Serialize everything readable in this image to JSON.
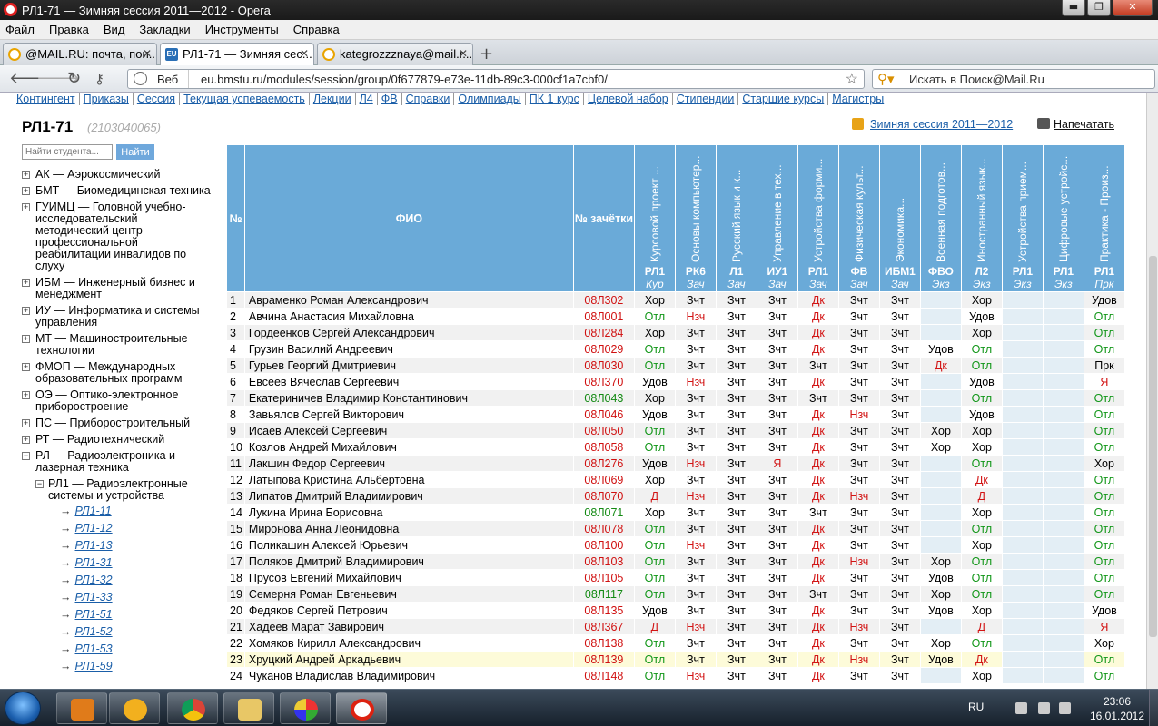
{
  "window": {
    "title": "РЛ1-71 — Зимняя сессия 2011—2012 - Opera",
    "min": "▬",
    "max": "❐",
    "close": "✕"
  },
  "menu": [
    "Файл",
    "Правка",
    "Вид",
    "Закладки",
    "Инструменты",
    "Справка"
  ],
  "tabs": [
    {
      "label": "@MAIL.RU: почта, пои...",
      "active": false
    },
    {
      "label": "РЛ1-71 — Зимняя сес...",
      "active": true
    },
    {
      "label": "kategrozzznaya@mail.r...",
      "active": false
    }
  ],
  "address": {
    "web_label": "Веб",
    "url": "eu.bmstu.ru/modules/session/group/0f677879-e73e-11db-89c3-000cf1a7cbf0/",
    "search_placeholder": "Искать в Поиск@Mail.Ru"
  },
  "topnav": [
    "Контингент",
    "Приказы",
    "Сессия",
    "Текущая успеваемость",
    "Лекции",
    "Л4",
    "ФВ",
    "Справки",
    "Олимпиады",
    "ПК 1 курс",
    "Целевой набор",
    "Стипендии",
    "Старшие курсы",
    "Магистры"
  ],
  "group": {
    "title": "РЛ1-71",
    "code": "(2103040065)"
  },
  "session_link": "Зимняя сессия 2011—2012",
  "print_link": "Напечатать",
  "search": {
    "placeholder": "Найти студента...",
    "button": "Найти"
  },
  "tree": [
    {
      "abbr": "АК",
      "name": "Аэрокосмический"
    },
    {
      "abbr": "БМТ",
      "name": "Биомедицинская техника"
    },
    {
      "abbr": "ГУИМЦ",
      "name": "Головной учебно-исследовательский методический центр профессиональной реабилитации инвалидов по слуху"
    },
    {
      "abbr": "ИБМ",
      "name": "Инженерный бизнес и менеджмент"
    },
    {
      "abbr": "ИУ",
      "name": "Информатика и системы управления"
    },
    {
      "abbr": "МТ",
      "name": "Машиностроительные технологии"
    },
    {
      "abbr": "ФМОП",
      "name": "Международных образовательных программ"
    },
    {
      "abbr": "ОЭ",
      "name": "Оптико-электронное приборостроение"
    },
    {
      "abbr": "ПС",
      "name": "Приборостроительный"
    },
    {
      "abbr": "РТ",
      "name": "Радиотехнический"
    },
    {
      "abbr": "РЛ",
      "name": "Радиоэлектроника и лазерная техника",
      "expanded": true
    }
  ],
  "tree_sub": {
    "abbr": "РЛ1",
    "name": "Радиоэлектронные системы и устройства"
  },
  "tree_groups": [
    "РЛ1-11",
    "РЛ1-12",
    "РЛ1-13",
    "РЛ1-31",
    "РЛ1-32",
    "РЛ1-33",
    "РЛ1-51",
    "РЛ1-52",
    "РЛ1-53",
    "РЛ1-59"
  ],
  "table": {
    "h_num": "№",
    "h_fio": "ФИО",
    "h_rec": "№ зачётки",
    "subjects": [
      {
        "name": "Курсовой проект ...",
        "code": "РЛ1",
        "kind": "Кур"
      },
      {
        "name": "Основы компьютер...",
        "code": "РК6",
        "kind": "Зач"
      },
      {
        "name": "Русский язык и к...",
        "code": "Л1",
        "kind": "Зач"
      },
      {
        "name": "Управление в тех...",
        "code": "ИУ1",
        "kind": "Зач"
      },
      {
        "name": "Устройства форми...",
        "code": "РЛ1",
        "kind": "Зач"
      },
      {
        "name": "Физическая культ...",
        "code": "ФВ",
        "kind": "Зач"
      },
      {
        "name": "Экономика...",
        "code": "ИБМ1",
        "kind": "Зач"
      },
      {
        "name": "Военная подготов...",
        "code": "ФВО",
        "kind": "Экз"
      },
      {
        "name": "Иностранный язык...",
        "code": "Л2",
        "kind": "Экз"
      },
      {
        "name": "Устройства прием...",
        "code": "РЛ1",
        "kind": "Экз"
      },
      {
        "name": "Цифровые устройс...",
        "code": "РЛ1",
        "kind": "Экз"
      },
      {
        "name": "Практика - Произ...",
        "code": "РЛ1",
        "kind": "Прк"
      }
    ],
    "rows": [
      {
        "n": "1",
        "fio": "Авраменко Роман Александрович",
        "rec": "08Л302",
        "rc": "red",
        "g": [
          "Хор",
          "Зчт",
          "Зчт",
          "Зчт",
          "Дк",
          "Зчт",
          "Зчт",
          "",
          "Хор",
          "",
          "",
          "Удов"
        ]
      },
      {
        "n": "2",
        "fio": "Авчина Анастасия Михайловна",
        "rec": "08Л001",
        "rc": "red",
        "g": [
          "Отл",
          "Нзч",
          "Зчт",
          "Зчт",
          "Дк",
          "Зчт",
          "Зчт",
          "",
          "Удов",
          "",
          "",
          "Отл"
        ]
      },
      {
        "n": "3",
        "fio": "Гордеенков Сергей Александрович",
        "rec": "08Л284",
        "rc": "red",
        "g": [
          "Хор",
          "Зчт",
          "Зчт",
          "Зчт",
          "Дк",
          "Зчт",
          "Зчт",
          "",
          "Хор",
          "",
          "",
          "Отл"
        ]
      },
      {
        "n": "4",
        "fio": "Грузин Василий Андреевич",
        "rec": "08Л029",
        "rc": "red",
        "g": [
          "Отл",
          "Зчт",
          "Зчт",
          "Зчт",
          "Дк",
          "Зчт",
          "Зчт",
          "Удов",
          "Отл",
          "",
          "",
          "Отл"
        ]
      },
      {
        "n": "5",
        "fio": "Гурьев Георгий Дмитриевич",
        "rec": "08Л030",
        "rc": "red",
        "g": [
          "Отл",
          "Зчт",
          "Зчт",
          "Зчт",
          "Зчт",
          "Зчт",
          "Зчт",
          "Дк",
          "Отл",
          "",
          "",
          "Прк"
        ]
      },
      {
        "n": "6",
        "fio": "Евсеев Вячеслав Сергеевич",
        "rec": "08Л370",
        "rc": "red",
        "g": [
          "Удов",
          "Нзч",
          "Зчт",
          "Зчт",
          "Дк",
          "Зчт",
          "Зчт",
          "",
          "Удов",
          "",
          "",
          "Я"
        ]
      },
      {
        "n": "7",
        "fio": "Екатериничев Владимир Константинович",
        "rec": "08Л043",
        "rc": "green",
        "g": [
          "Хор",
          "Зчт",
          "Зчт",
          "Зчт",
          "Зчт",
          "Зчт",
          "Зчт",
          "",
          "Отл",
          "",
          "",
          "Отл"
        ]
      },
      {
        "n": "8",
        "fio": "Завьялов Сергей Викторович",
        "rec": "08Л046",
        "rc": "red",
        "g": [
          "Удов",
          "Зчт",
          "Зчт",
          "Зчт",
          "Дк",
          "Нзч",
          "Зчт",
          "",
          "Удов",
          "",
          "",
          "Отл"
        ]
      },
      {
        "n": "9",
        "fio": "Исаев Алексей Сергеевич",
        "rec": "08Л050",
        "rc": "red",
        "g": [
          "Отл",
          "Зчт",
          "Зчт",
          "Зчт",
          "Дк",
          "Зчт",
          "Зчт",
          "Хор",
          "Хор",
          "",
          "",
          "Отл"
        ]
      },
      {
        "n": "10",
        "fio": "Козлов Андрей Михайлович",
        "rec": "08Л058",
        "rc": "red",
        "g": [
          "Отл",
          "Зчт",
          "Зчт",
          "Зчт",
          "Дк",
          "Зчт",
          "Зчт",
          "Хор",
          "Хор",
          "",
          "",
          "Отл"
        ]
      },
      {
        "n": "11",
        "fio": "Лакшин Федор Сергеевич",
        "rec": "08Л276",
        "rc": "red",
        "g": [
          "Удов",
          "Нзч",
          "Зчт",
          "Я",
          "Дк",
          "Зчт",
          "Зчт",
          "",
          "Отл",
          "",
          "",
          "Хор"
        ]
      },
      {
        "n": "12",
        "fio": "Латыпова Кристина Альбертовна",
        "rec": "08Л069",
        "rc": "red",
        "g": [
          "Хор",
          "Зчт",
          "Зчт",
          "Зчт",
          "Дк",
          "Зчт",
          "Зчт",
          "",
          "Дк",
          "",
          "",
          "Отл"
        ]
      },
      {
        "n": "13",
        "fio": "Липатов Дмитрий Владимирович",
        "rec": "08Л070",
        "rc": "red",
        "g": [
          "Д",
          "Нзч",
          "Зчт",
          "Зчт",
          "Дк",
          "Нзч",
          "Зчт",
          "",
          "Д",
          "",
          "",
          "Отл"
        ]
      },
      {
        "n": "14",
        "fio": "Лукина Ирина Борисовна",
        "rec": "08Л071",
        "rc": "green",
        "g": [
          "Хор",
          "Зчт",
          "Зчт",
          "Зчт",
          "Зчт",
          "Зчт",
          "Зчт",
          "",
          "Хор",
          "",
          "",
          "Отл"
        ]
      },
      {
        "n": "15",
        "fio": "Миронова Анна Леонидовна",
        "rec": "08Л078",
        "rc": "red",
        "g": [
          "Отл",
          "Зчт",
          "Зчт",
          "Зчт",
          "Дк",
          "Зчт",
          "Зчт",
          "",
          "Отл",
          "",
          "",
          "Отл"
        ]
      },
      {
        "n": "16",
        "fio": "Поликашин Алексей Юрьевич",
        "rec": "08Л100",
        "rc": "red",
        "g": [
          "Отл",
          "Нзч",
          "Зчт",
          "Зчт",
          "Дк",
          "Зчт",
          "Зчт",
          "",
          "Хор",
          "",
          "",
          "Отл"
        ]
      },
      {
        "n": "17",
        "fio": "Поляков Дмитрий Владимирович",
        "rec": "08Л103",
        "rc": "red",
        "g": [
          "Отл",
          "Зчт",
          "Зчт",
          "Зчт",
          "Дк",
          "Нзч",
          "Зчт",
          "Хор",
          "Отл",
          "",
          "",
          "Отл"
        ]
      },
      {
        "n": "18",
        "fio": "Прусов Евгений Михайлович",
        "rec": "08Л105",
        "rc": "red",
        "g": [
          "Отл",
          "Зчт",
          "Зчт",
          "Зчт",
          "Дк",
          "Зчт",
          "Зчт",
          "Удов",
          "Отл",
          "",
          "",
          "Отл"
        ]
      },
      {
        "n": "19",
        "fio": "Семерня Роман Евгеньевич",
        "rec": "08Л117",
        "rc": "green",
        "g": [
          "Отл",
          "Зчт",
          "Зчт",
          "Зчт",
          "Зчт",
          "Зчт",
          "Зчт",
          "Хор",
          "Отл",
          "",
          "",
          "Отл"
        ]
      },
      {
        "n": "20",
        "fio": "Федяков Сергей Петрович",
        "rec": "08Л135",
        "rc": "red",
        "g": [
          "Удов",
          "Зчт",
          "Зчт",
          "Зчт",
          "Дк",
          "Зчт",
          "Зчт",
          "Удов",
          "Хор",
          "",
          "",
          "Удов"
        ]
      },
      {
        "n": "21",
        "fio": "Хадеев Марат Завирович",
        "rec": "08Л367",
        "rc": "red",
        "g": [
          "Д",
          "Нзч",
          "Зчт",
          "Зчт",
          "Дк",
          "Нзч",
          "Зчт",
          "",
          "Д",
          "",
          "",
          "Я"
        ]
      },
      {
        "n": "22",
        "fio": "Хомяков Кирилл Александрович",
        "rec": "08Л138",
        "rc": "red",
        "g": [
          "Отл",
          "Зчт",
          "Зчт",
          "Зчт",
          "Дк",
          "Зчт",
          "Зчт",
          "Хор",
          "Отл",
          "",
          "",
          "Хор"
        ]
      },
      {
        "n": "23",
        "fio": "Хруцкий Андрей Аркадьевич",
        "rec": "08Л139",
        "rc": "red",
        "g": [
          "Отл",
          "Зчт",
          "Зчт",
          "Зчт",
          "Дк",
          "Нзч",
          "Зчт",
          "Удов",
          "Дк",
          "",
          "",
          "Отл"
        ],
        "hl": true
      },
      {
        "n": "24",
        "fio": "Чуканов Владислав Владимирович",
        "rec": "08Л148",
        "rc": "red",
        "g": [
          "Отл",
          "Нзч",
          "Зчт",
          "Зчт",
          "Дк",
          "Зчт",
          "Зчт",
          "",
          "Хор",
          "",
          "",
          "Отл"
        ]
      }
    ]
  },
  "grade_colors": {
    "good": [
      "Отл"
    ],
    "bad": [
      "Нзч",
      "Дк",
      "Д",
      "Я"
    ]
  },
  "taskbar": {
    "lang": "RU",
    "time": "23:06",
    "date": "16.01.2012"
  },
  "colors": {
    "header_blue": "#6aaad8",
    "link_blue": "#1a5ea8",
    "red": "#d21414",
    "green": "#13971a"
  }
}
